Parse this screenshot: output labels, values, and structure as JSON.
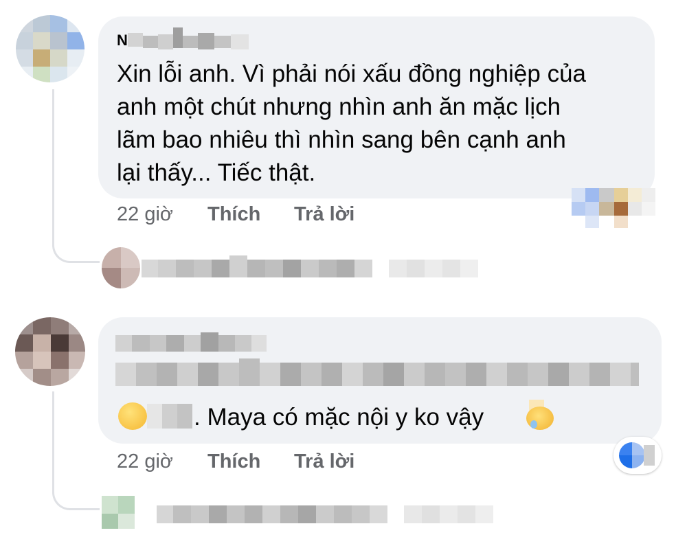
{
  "comments": [
    {
      "author_visible": "N",
      "text_lines": [
        "Xin lỗi anh. Vì phải nói xấu đồng nghiệp của",
        "anh một chút nhưng nhìn anh ăn mặc lịch",
        "lãm bao nhiêu thì nhìn sang bên cạnh anh",
        "lại thấy... Tiếc thật."
      ],
      "time": "22 giờ",
      "like_label": "Thích",
      "reply_label": "Trả lời"
    },
    {
      "author_visible": "",
      "text_visible": ". Maya có mặc nội y ko vậy",
      "time": "22 giờ",
      "like_label": "Thích",
      "reply_label": "Trả lời"
    }
  ],
  "icons": {
    "avatar_1": "blurred-avatar-icon",
    "avatar_2": "blurred-avatar-icon",
    "reaction_1": "blurred-reaction-icon",
    "reaction_2": "like-reaction-icon",
    "emoji_start": "smiley-emoji-icon",
    "emoji_end": "sweat-emoji-icon"
  },
  "colors": {
    "bubble": "#f0f2f5",
    "meta_text": "#65676b",
    "text": "#050505",
    "thread_line": "#dfe1e5"
  }
}
